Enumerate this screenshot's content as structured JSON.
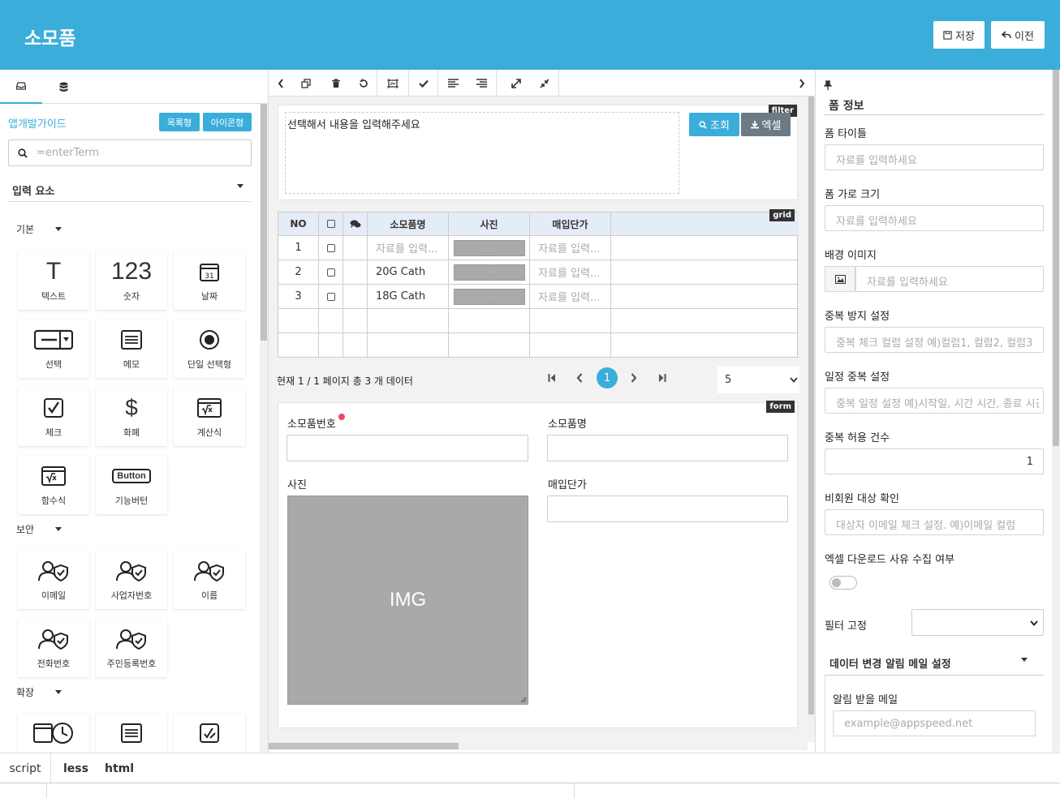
{
  "header": {
    "title": "소모품",
    "save_label": "저장",
    "back_label": "이전"
  },
  "left": {
    "guide_link": "앱개발가이드",
    "list_btn": "목록형",
    "icon_btn": "아이콘형",
    "search_placeholder": "=enterTerm",
    "section_title": "입력 요소",
    "groups": {
      "basic": "기본",
      "security": "보안",
      "extend": "확장"
    },
    "tiles": {
      "text": "텍스트",
      "number": "숫자",
      "date": "날짜",
      "select": "선택",
      "memo": "메모",
      "radio": "단일 선택형",
      "check": "체크",
      "currency": "화폐",
      "calc": "계산식",
      "func": "함수식",
      "funcbtn": "기능버턴",
      "email": "이메일",
      "bizno": "사업자번호",
      "name": "이름",
      "phone": "전화번호",
      "rrn": "주민등록번호"
    },
    "glyphs": {
      "text": "T",
      "number": "123",
      "currency": "$",
      "button": "Button",
      "date_num": "31"
    }
  },
  "center": {
    "filter_tag": "filter",
    "filter_text": "선택해서 내용을 입력해주세요",
    "search_btn": "조회",
    "excel_btn": "엑셀",
    "grid_tag": "grid",
    "columns": [
      "NO",
      "소모품명",
      "사진",
      "매입단가"
    ],
    "rows": [
      {
        "no": "1",
        "name": "",
        "price": ""
      },
      {
        "no": "2",
        "name": "20G Cath",
        "price": ""
      },
      {
        "no": "3",
        "name": "18G Cath",
        "price": ""
      }
    ],
    "cell_placeholder": "자료를 입력...",
    "photo_placeholder": "—",
    "paging_text": "현재 1 / 1 페이지 총 3 개 데이터",
    "current_page": "1",
    "page_size": "5",
    "form_tag": "form",
    "form": {
      "field1": "소모품번호",
      "field2": "소모품명",
      "field3": "사진",
      "field4": "매입단가",
      "img_text": "IMG"
    }
  },
  "right": {
    "section": "폼 정보",
    "labels": {
      "form_title": "폼 타이틀",
      "form_width": "폼 가로 크기",
      "bg_image": "배경 이미지",
      "dup_prevent": "중복 방지 설정",
      "sched_dup": "일정 중복 설정",
      "dup_count": "중복 허용 건수",
      "nonmember": "비회원 대상 확인",
      "excel_reason": "엑셀 다운로드 사유 수집 여부",
      "filter_fix": "필터 고정",
      "notify_section": "데이터 변경 알림 메일 설정",
      "notify_mail": "알림 받을 메일"
    },
    "placeholders": {
      "form_title": "자료를 입력하세요",
      "form_width": "자료를 입력하세요",
      "bg_image": "자료를 입력하세요",
      "dup_prevent": "중복 체크 컬럼 설정 예)컬럼1, 컬럼2, 컬럼3",
      "sched_dup": "중복 일정 설정 예)시작일, 시간 시간, 종료 시간",
      "nonmember": "대상자 이메일 체크 설정. 예)이메일 컬럼",
      "notify_mail": "example@appspeed.net"
    },
    "dup_count_value": "1"
  },
  "bottom": {
    "tabs": [
      "script",
      "less",
      "html"
    ]
  }
}
